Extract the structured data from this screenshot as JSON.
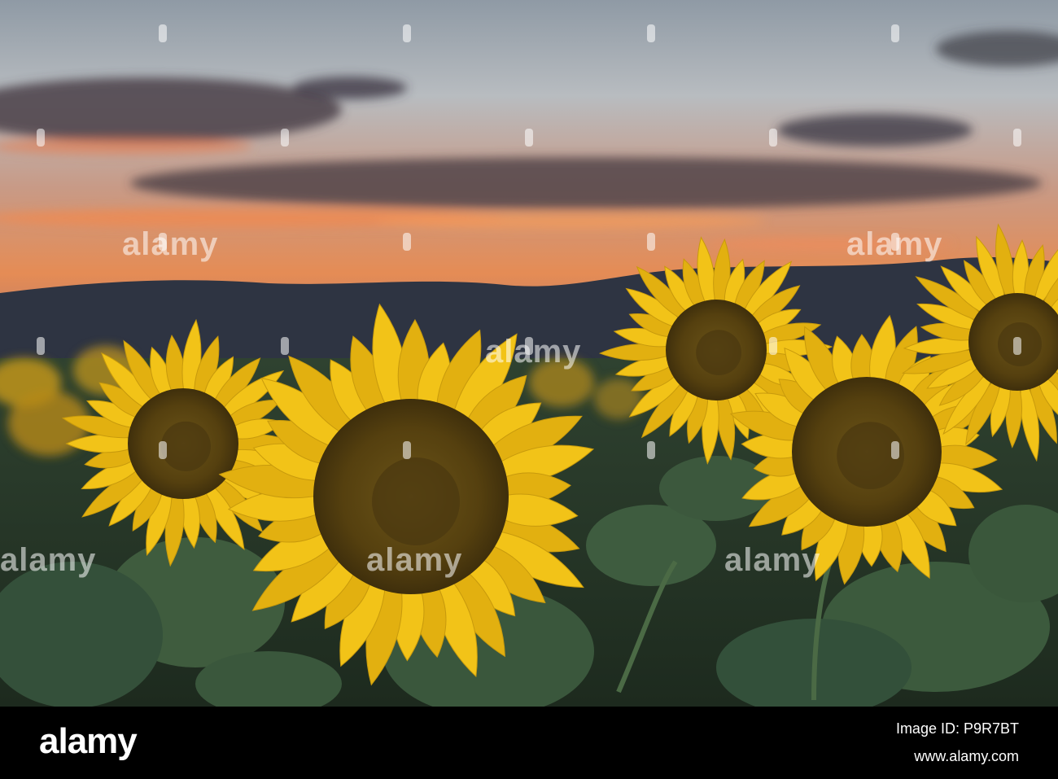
{
  "photo": {
    "subject": "sunflower-field-at-sunset",
    "colors": {
      "sky_orange": "#e88a4f",
      "sky_gray": "#b9bcc0",
      "mountains": "#2e3442",
      "petal": "#f2c318",
      "disk": "#5a4414",
      "leaf": "#3c5a3a"
    }
  },
  "watermark": {
    "label": "alamy"
  },
  "footer": {
    "brand": "alamy",
    "image_id_line": "Image ID: P9R7BT",
    "url": "www.alamy.com"
  }
}
